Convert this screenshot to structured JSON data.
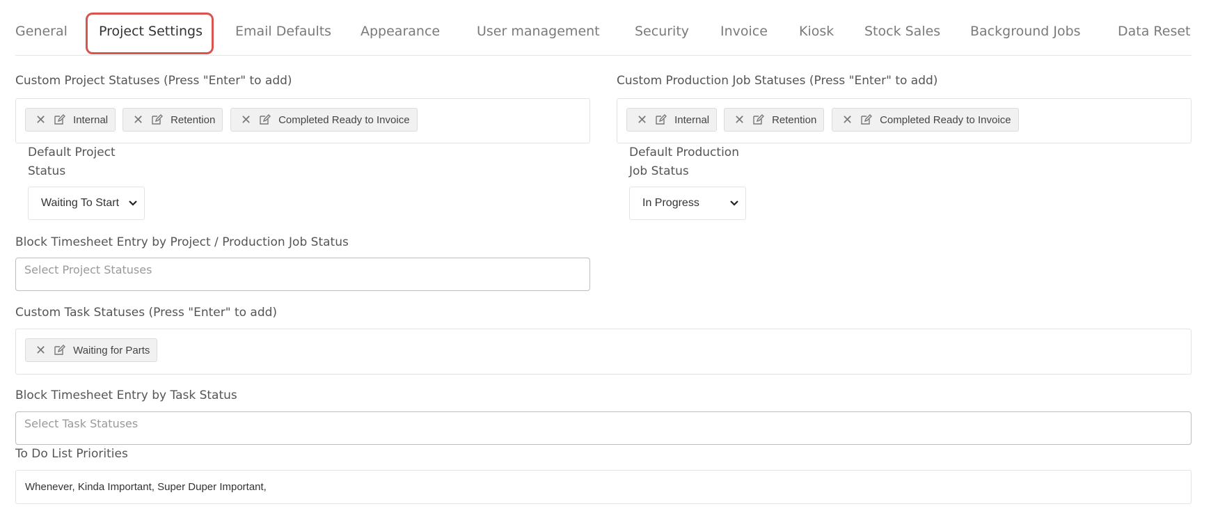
{
  "tabs": [
    {
      "label": "General",
      "active": false
    },
    {
      "label": "Project Settings",
      "active": true
    },
    {
      "label": "Email Defaults",
      "active": false
    },
    {
      "label": "Appearance",
      "active": false
    },
    {
      "label": "User management",
      "active": false
    },
    {
      "label": "Security",
      "active": false
    },
    {
      "label": "Invoice",
      "active": false
    },
    {
      "label": "Kiosk",
      "active": false
    },
    {
      "label": "Stock Sales",
      "active": false
    },
    {
      "label": "Background Jobs",
      "active": false
    },
    {
      "label": "Data Reset",
      "active": false
    }
  ],
  "project_statuses": {
    "label": "Custom Project Statuses (Press \"Enter\" to add)",
    "tags": [
      "Internal",
      "Retention",
      "Completed Ready to Invoice"
    ]
  },
  "production_statuses": {
    "label": "Custom Production Job Statuses (Press \"Enter\" to add)",
    "tags": [
      "Internal",
      "Retention",
      "Completed Ready to Invoice"
    ]
  },
  "default_project_status": {
    "label_line1": "Default Project",
    "label_line2": "Status",
    "value": "Waiting To Start"
  },
  "default_production_status": {
    "label_line1": "Default Production",
    "label_line2": "Job Status",
    "value": "In Progress"
  },
  "block_by_project": {
    "label": "Block Timesheet Entry by Project / Production Job Status",
    "placeholder": "Select Project Statuses"
  },
  "task_statuses": {
    "label": "Custom Task Statuses (Press \"Enter\" to add)",
    "tags": [
      "Waiting for Parts"
    ]
  },
  "block_by_task": {
    "label": "Block Timesheet Entry by Task Status",
    "placeholder": "Select Task Statuses"
  },
  "todo_priorities": {
    "label": "To Do List Priorities",
    "value": "Whenever, Kinda Important, Super Duper Important,"
  },
  "colors": {
    "active_tab_border": "#d9534f",
    "tag_background": "#f1f1f1"
  }
}
